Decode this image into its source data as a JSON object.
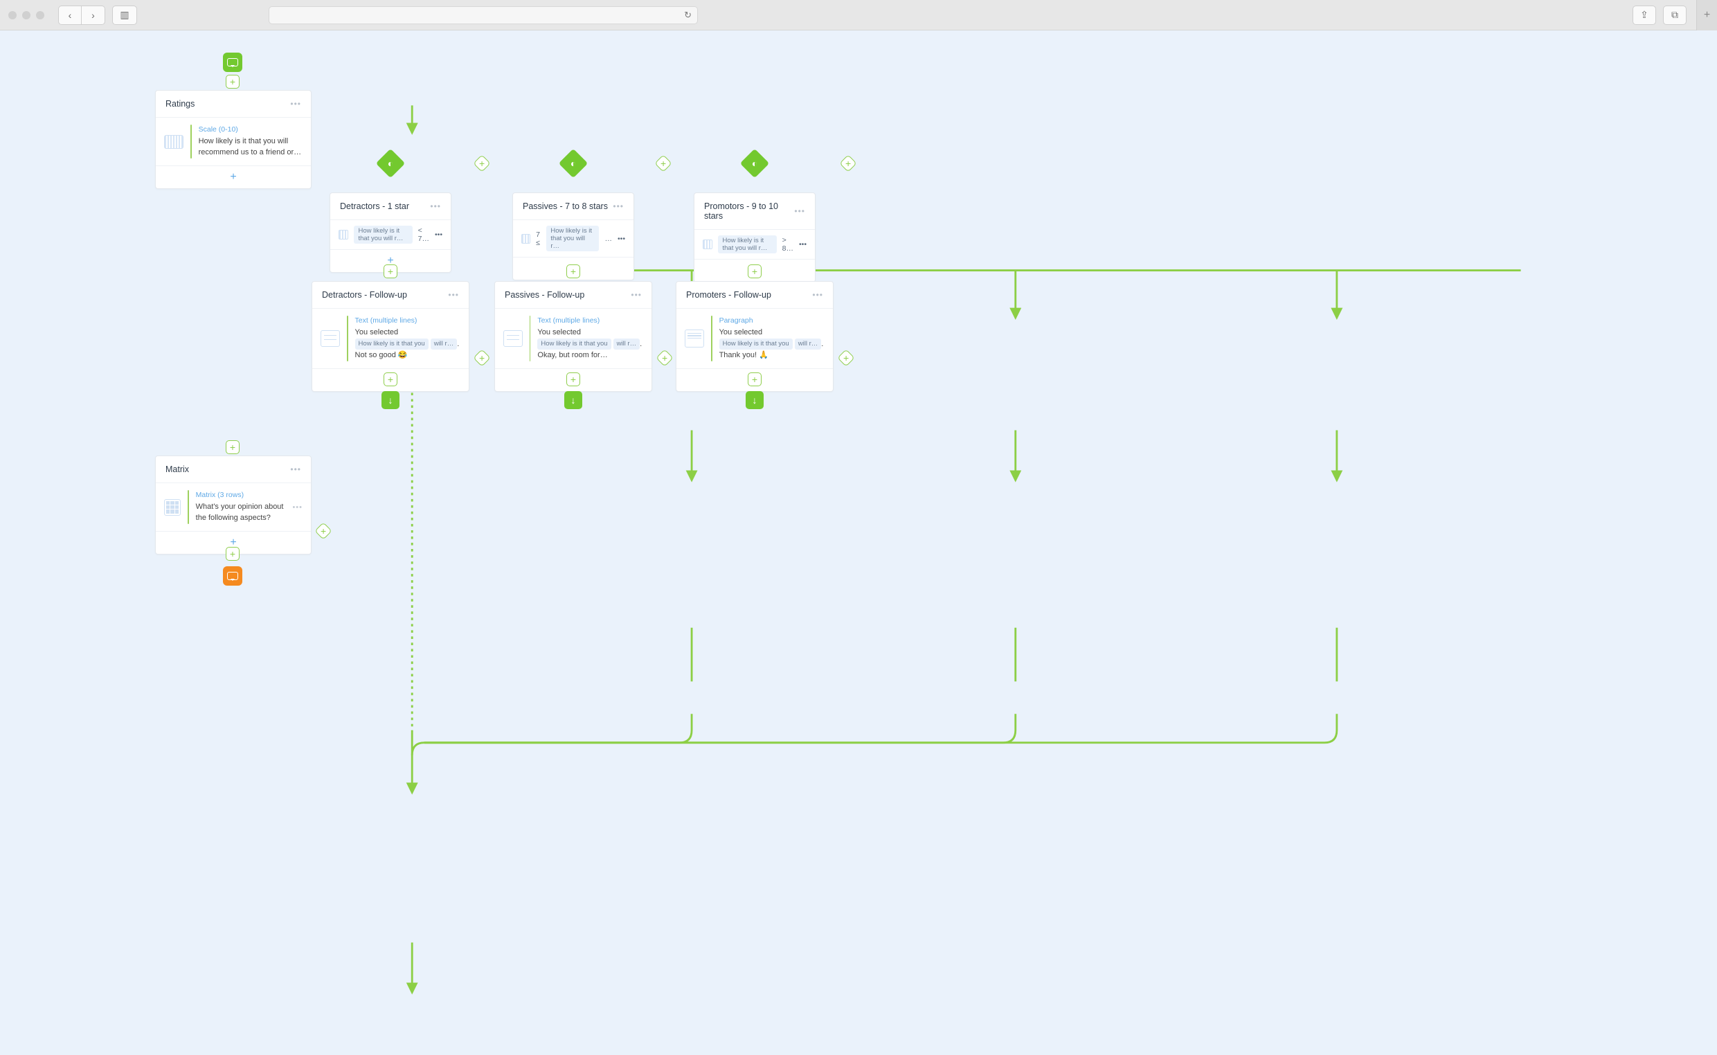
{
  "browser": {
    "back_icon": "‹",
    "forward_icon": "›",
    "sidebar_icon": "▥",
    "reload_icon": "↻",
    "share_icon": "⇪",
    "tabs_icon": "⧉",
    "newtab_icon": "+"
  },
  "flow": {
    "start_icon": "💬",
    "end_icon": "💬",
    "cards": {
      "ratings": {
        "title": "Ratings",
        "block_type": "Scale (0-10)",
        "text": "How likely is it that you will recommend us to a friend or…"
      },
      "detractors_cond": {
        "title": "Detractors - 1 star",
        "question_ref": "How likely is it that you will r…",
        "operator": "< 7…"
      },
      "passives_cond": {
        "title": "Passives - 7 to 8 stars",
        "question_ref": "How likely is it that you will r…",
        "operator_left": "7 ≤",
        "operator_right": "…"
      },
      "promotors_cond": {
        "title": "Promotors - 9 to 10 stars",
        "question_ref": "How likely is it that you will r…",
        "operator": "> 8…"
      },
      "detractors_follow": {
        "title": "Detractors - Follow-up",
        "block_type": "Text (multiple lines)",
        "prefix": "You selected",
        "question_ref_1": "How likely is it that you",
        "question_ref_2": "will r…",
        "suffix": ". Not so good 😂"
      },
      "passives_follow": {
        "title": "Passives - Follow-up",
        "block_type": "Text (multiple lines)",
        "prefix": "You selected",
        "question_ref_1": "How likely is it that you",
        "question_ref_2": "will r…",
        "suffix": ". Okay, but room for…"
      },
      "promoters_follow": {
        "title": "Promoters - Follow-up",
        "block_type": "Paragraph",
        "prefix": "You selected",
        "question_ref_1": "How likely is it that you",
        "question_ref_2": "will r…",
        "suffix": ". Thank you! 🙏"
      },
      "matrix": {
        "title": "Matrix",
        "block_type": "Matrix (3 rows)",
        "text": "What's your opinion about the following aspects?"
      }
    },
    "more_icon": "•••",
    "add_icon": "+",
    "down_icon": "↓",
    "cond_icon": "◐"
  }
}
